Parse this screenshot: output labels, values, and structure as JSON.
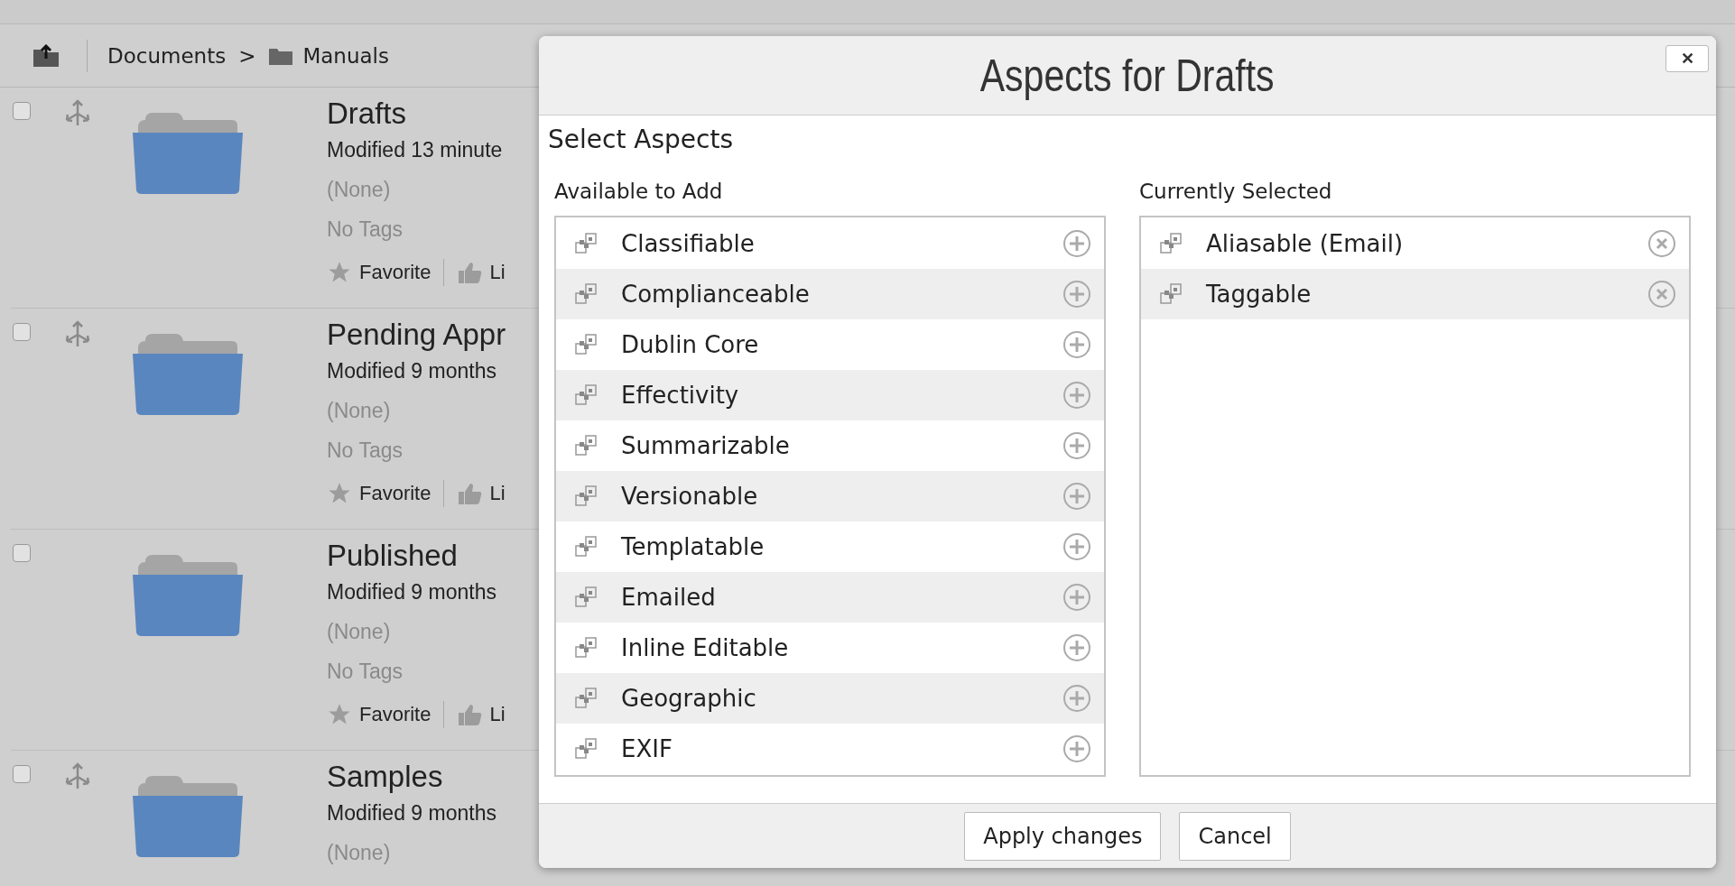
{
  "breadcrumb": [
    {
      "label": "Documents",
      "kind": "text"
    },
    {
      "label": ">",
      "kind": "separator"
    },
    {
      "label": "Manuals",
      "kind": "folder"
    }
  ],
  "items": [
    {
      "name": "Drafts",
      "modified": "Modified 13 minute",
      "description": "(None)",
      "tags": "No Tags",
      "favorite": "Favorite",
      "like": "Li",
      "checked": false,
      "movable": true
    },
    {
      "name": "Pending Appr",
      "modified": "Modified 9 months",
      "description": "(None)",
      "tags": "No Tags",
      "favorite": "Favorite",
      "like": "Li",
      "checked": false,
      "movable": true
    },
    {
      "name": "Published",
      "modified": "Modified 9 months",
      "description": "(None)",
      "tags": "No Tags",
      "favorite": "Favorite",
      "like": "Li",
      "checked": false,
      "movable": false
    },
    {
      "name": "Samples",
      "modified": "Modified 9 months",
      "description": "(None)",
      "checked": false,
      "movable": true
    }
  ],
  "dialog": {
    "title": "Aspects for Drafts",
    "close": "✕",
    "heading": "Select Aspects",
    "available": {
      "label": "Available to Add",
      "items": [
        "Classifiable",
        "Complianceable",
        "Dublin Core",
        "Effectivity",
        "Summarizable",
        "Versionable",
        "Templatable",
        "Emailed",
        "Inline Editable",
        "Geographic",
        "EXIF"
      ]
    },
    "selected": {
      "label": "Currently Selected",
      "items": [
        "Aliasable (Email)",
        "Taggable"
      ]
    },
    "buttons": [
      "Apply changes",
      "Cancel"
    ]
  }
}
